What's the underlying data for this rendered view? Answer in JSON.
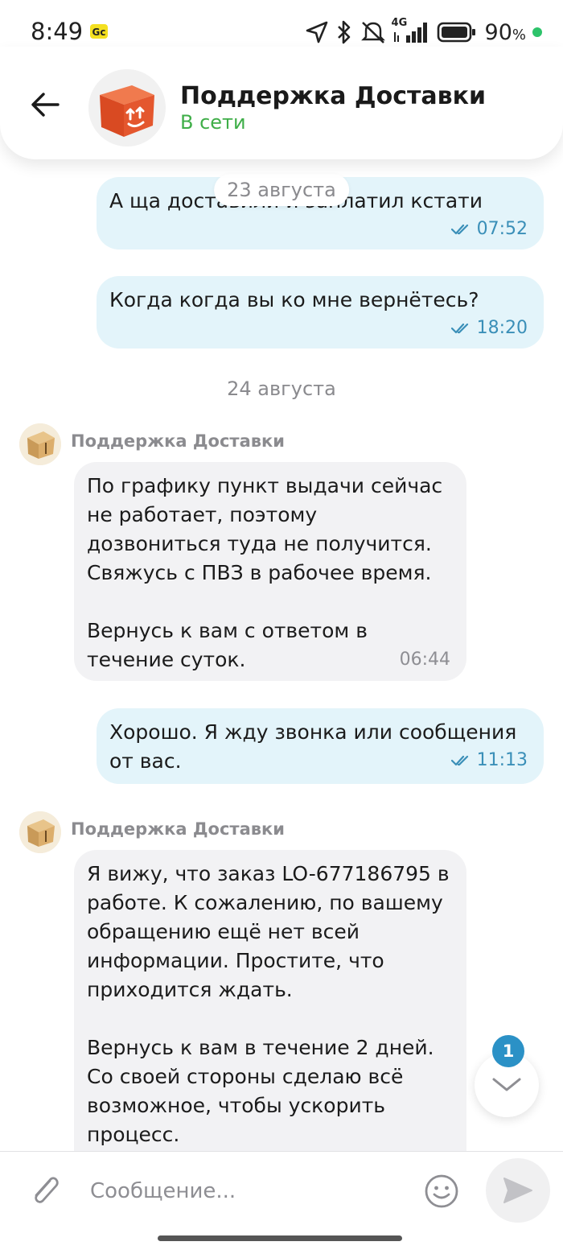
{
  "status_bar": {
    "time": "8:49",
    "network": "4G",
    "battery": "90",
    "battery_unit": "%"
  },
  "header": {
    "title": "Поддержка Доставки",
    "presence": "В сети"
  },
  "messages": [
    {
      "id": "m1",
      "direction": "out",
      "text": [
        "А ща доставили и заплатил кстати"
      ],
      "time": "07:52"
    },
    {
      "id": "m2",
      "direction": "out",
      "text": [
        "Когда когда вы ко мне вернётесь?"
      ],
      "time": "18:20"
    },
    {
      "id": "m3",
      "direction": "in",
      "sender": "Поддержка Доставки",
      "paragraphs": [
        "По графику пункт выдачи сейчас не работает, поэтому дозвониться туда не получится. Свяжусь с ПВЗ в рабочее время.",
        "Вернусь к вам с ответом в течение суток."
      ],
      "time": "06:44"
    },
    {
      "id": "m4",
      "direction": "out",
      "text": [
        "Хорошо. Я жду звонка или сообщения от вас."
      ],
      "time": "11:13"
    },
    {
      "id": "m5",
      "direction": "in",
      "sender": "Поддержка Доставки",
      "paragraphs": [
        "Я вижу, что заказ LO-677186795 в работе. К сожалению, по вашему обращению ещё нет всей информации. Простите, что приходится ждать.",
        "Вернусь к вам в течение 2 дней. Со своей стороны сделаю всё возможное, чтобы ускорить процесс."
      ]
    }
  ],
  "dates": {
    "floating": "23 августа",
    "separator_1": "24 августа"
  },
  "scroll_down": {
    "unread_count": "1"
  },
  "composer": {
    "placeholder": "Сообщение..."
  },
  "colors": {
    "outgoing_bubble": "#e3f4fa",
    "incoming_bubble": "#f2f2f4",
    "online": "#3fae48",
    "accent": "#2b91c6",
    "brand_box": "#e4572e"
  },
  "icons": [
    "back-arrow-icon",
    "double-check-icon",
    "paperclip-icon",
    "emoji-icon",
    "send-icon",
    "chevron-down-icon",
    "location-arrow-icon",
    "bluetooth-icon",
    "mute-icon",
    "signal-icon",
    "battery-icon"
  ]
}
